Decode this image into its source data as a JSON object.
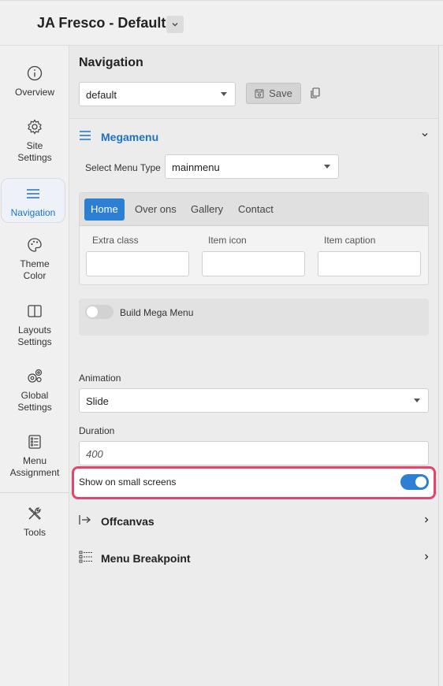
{
  "app": {
    "title": "JA Fresco - Default"
  },
  "sidebar": {
    "items": [
      {
        "label": "Overview",
        "icon": "info-icon"
      },
      {
        "label": "Site Settings",
        "icon": "gear-icon"
      },
      {
        "label": "Navigation",
        "icon": "menu-icon",
        "active": true
      },
      {
        "label": "Theme Color",
        "icon": "palette-icon"
      },
      {
        "label": "Layouts Settings",
        "icon": "layout-icon"
      },
      {
        "label": "Global Settings",
        "icon": "gears-icon"
      },
      {
        "label": "Menu Assignment",
        "icon": "list-icon"
      },
      {
        "label": "Tools",
        "icon": "tools-icon"
      }
    ]
  },
  "navigation": {
    "heading": "Navigation",
    "preset_select": "default",
    "save_label": "Save"
  },
  "megamenu": {
    "label": "Megamenu",
    "select_menu_type_label": "Select Menu Type",
    "menu_type": "mainmenu",
    "tabs": [
      "Home",
      "Over ons",
      "Gallery",
      "Contact"
    ],
    "active_tab": "Home",
    "fields": [
      "Extra class",
      "Item icon",
      "Item caption"
    ],
    "build_mega_menu_label": "Build Mega Menu",
    "build_mega_menu_on": false
  },
  "animation": {
    "label": "Animation",
    "value": "Slide"
  },
  "duration": {
    "label": "Duration",
    "placeholder": "400"
  },
  "small_screens": {
    "label": "Show on small screens",
    "enabled": true
  },
  "sections": [
    {
      "label": "Offcanvas",
      "icon": "arrow-right-bar-icon"
    },
    {
      "label": "Menu Breakpoint",
      "icon": "breakpoint-icon"
    }
  ],
  "colors": {
    "accent": "#1b72c8",
    "highlight": "#e8446b"
  }
}
